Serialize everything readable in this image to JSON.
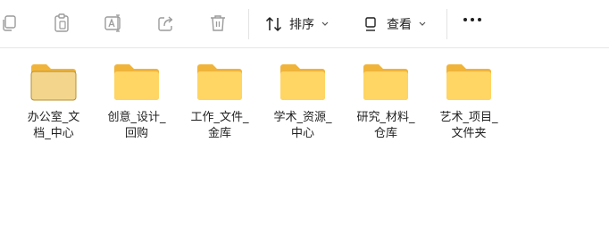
{
  "toolbar": {
    "sort_label": "排序",
    "view_label": "查看"
  },
  "colors": {
    "folder_back": "#f0b43a",
    "folder_front": "#ffd563",
    "folder_selected_front": "#f3d68c",
    "icon_gray": "#9b9b9b"
  },
  "files": [
    {
      "line1": "办公室_文",
      "line2": "档_中心",
      "selected": true
    },
    {
      "line1": "创意_设计_",
      "line2": "回购",
      "selected": false
    },
    {
      "line1": "工作_文件_",
      "line2": "金库",
      "selected": false
    },
    {
      "line1": "学术_资源_",
      "line2": "中心",
      "selected": false
    },
    {
      "line1": "研究_材料_",
      "line2": "仓库",
      "selected": false
    },
    {
      "line1": "艺术_项目_",
      "line2": "文件夹",
      "selected": false
    }
  ]
}
